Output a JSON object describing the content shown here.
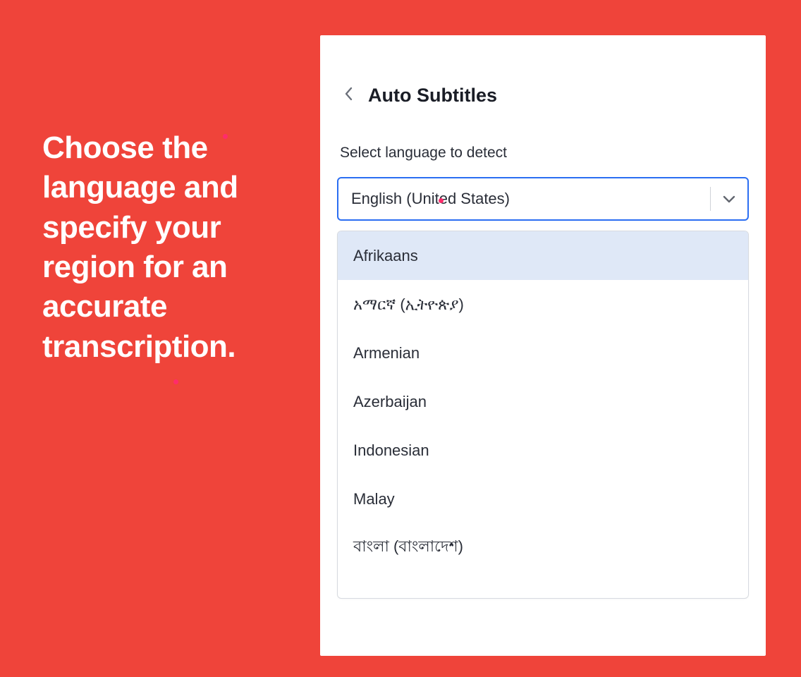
{
  "instruction_text": "Choose the language and specify your region for an accurate transcription.",
  "panel": {
    "title": "Auto Subtitles",
    "field_label": "Select language to detect",
    "select": {
      "value": "English (United States)"
    },
    "dropdown": {
      "highlighted_index": 0,
      "items": [
        {
          "label": "Afrikaans"
        },
        {
          "label": "አማርኛ (ኢትዮጵያ)"
        },
        {
          "label": "Armenian"
        },
        {
          "label": "Azerbaijan"
        },
        {
          "label": "Indonesian"
        },
        {
          "label": "Malay"
        },
        {
          "label": "বাংলা (বাংলাদেশ)"
        }
      ]
    }
  }
}
